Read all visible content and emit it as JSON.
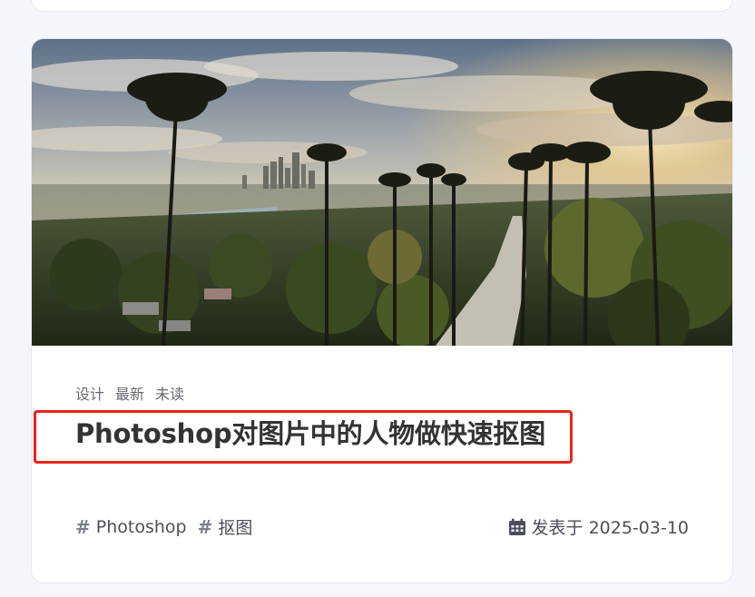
{
  "post": {
    "categories": [
      "设计",
      "最新",
      "未读"
    ],
    "title": "Photoshop对图片中的人物做快速抠图",
    "excerpt": "",
    "tags": [
      {
        "hash": "#",
        "label": "Photoshop"
      },
      {
        "hash": "#",
        "label": "抠图"
      }
    ],
    "date_label": "发表于 2025-03-10",
    "icons": {
      "tag": "hash-icon",
      "date": "calendar-icon"
    }
  },
  "colors": {
    "highlight": "#e8251a",
    "title": "#333333",
    "meta": "#4a4f59"
  }
}
